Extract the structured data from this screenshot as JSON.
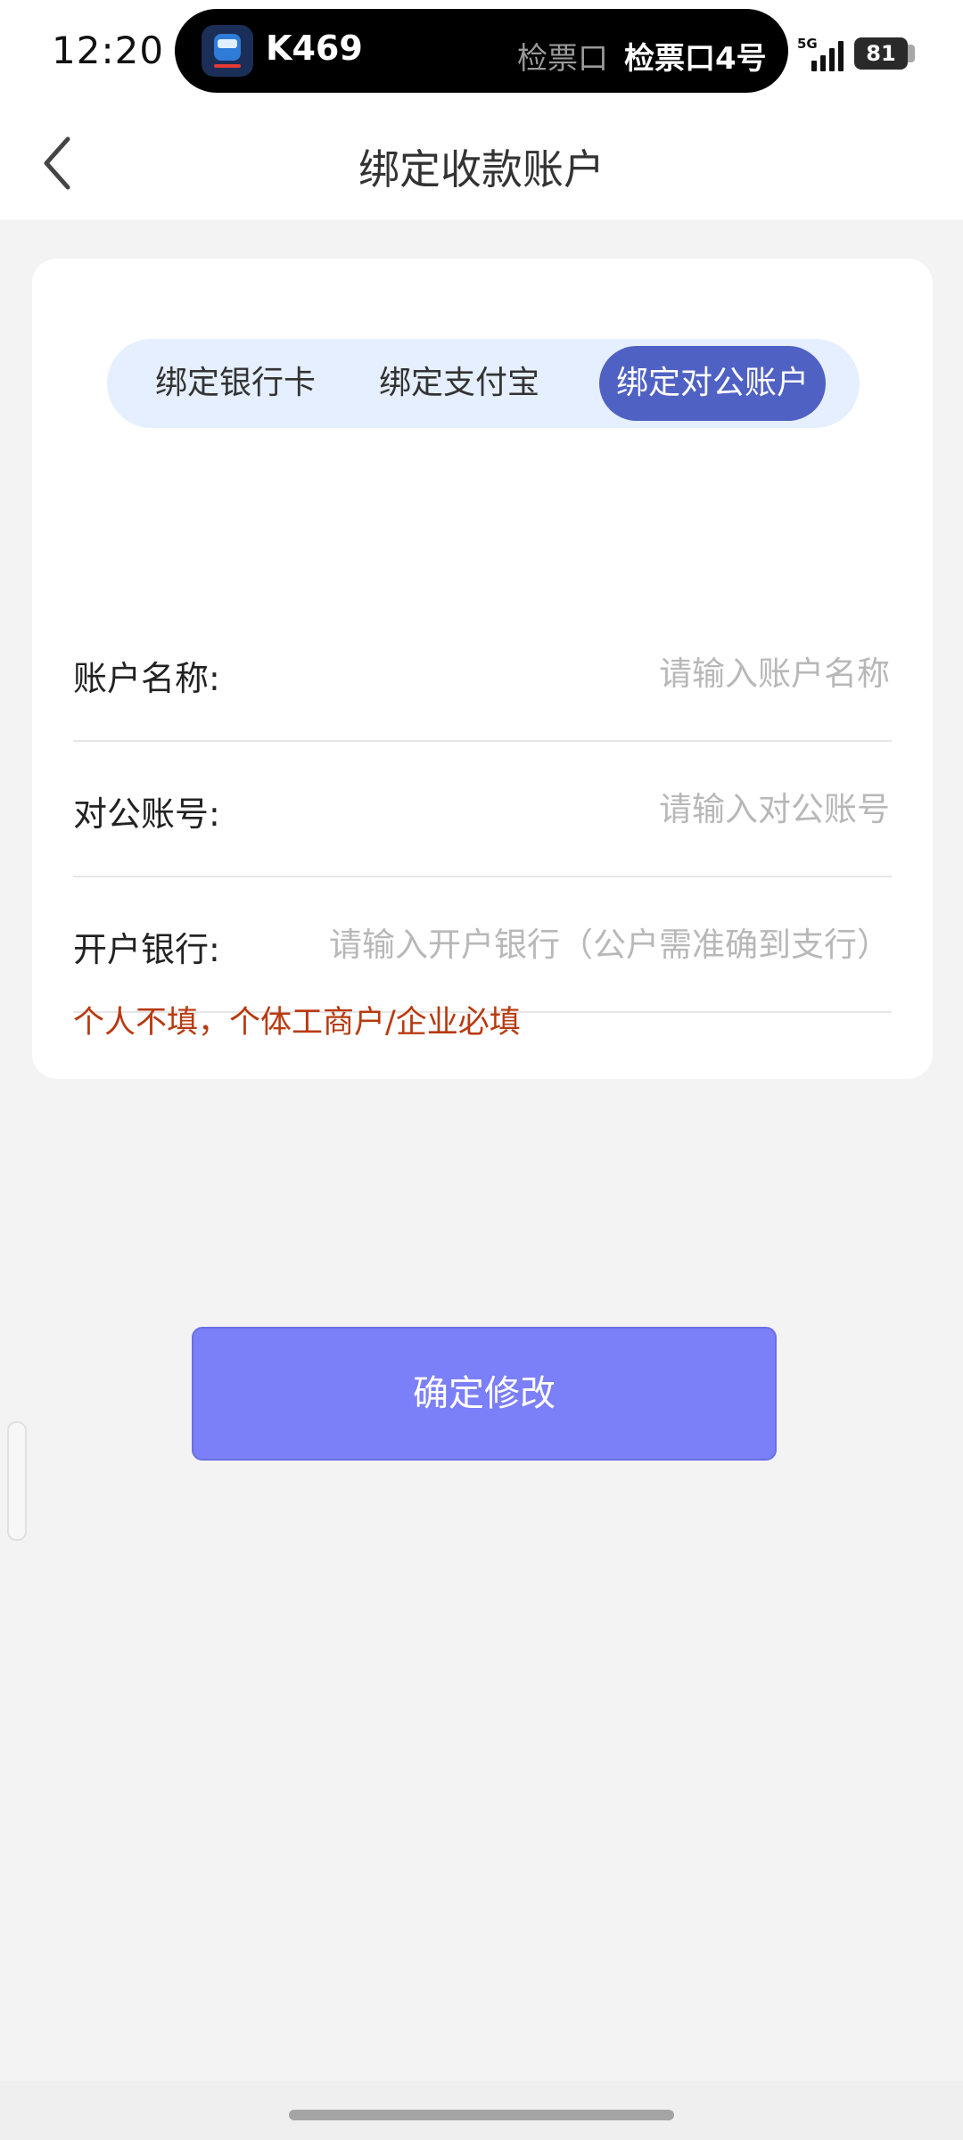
{
  "status_bar": {
    "time": "12:20",
    "train_number": "K469",
    "gate_label_dim": "检票口",
    "gate_label": "检票口4号",
    "network": "5G",
    "battery": "81"
  },
  "nav": {
    "title": "绑定收款账户"
  },
  "tabs": [
    {
      "label": "绑定银行卡",
      "active": false
    },
    {
      "label": "绑定支付宝",
      "active": false
    },
    {
      "label": "绑定对公账户",
      "active": true
    }
  ],
  "form": {
    "account_name": {
      "label": "账户名称:",
      "placeholder": "请输入账户名称",
      "value": ""
    },
    "account_number": {
      "label": "对公账号:",
      "placeholder": "请输入对公账号",
      "value": ""
    },
    "bank": {
      "label": "开户银行:",
      "placeholder": "请输入开户银行（公户需准确到支行）",
      "value": ""
    },
    "note": "个人不填，个体工商户/企业必填"
  },
  "confirm_button": {
    "label": "确定修改"
  },
  "colors": {
    "accent": "#7b7ff8",
    "active_tab": "#5061c4",
    "tab_bg": "#e5efff",
    "note": "#b83a0f",
    "page_bg": "#f3f3f3"
  }
}
